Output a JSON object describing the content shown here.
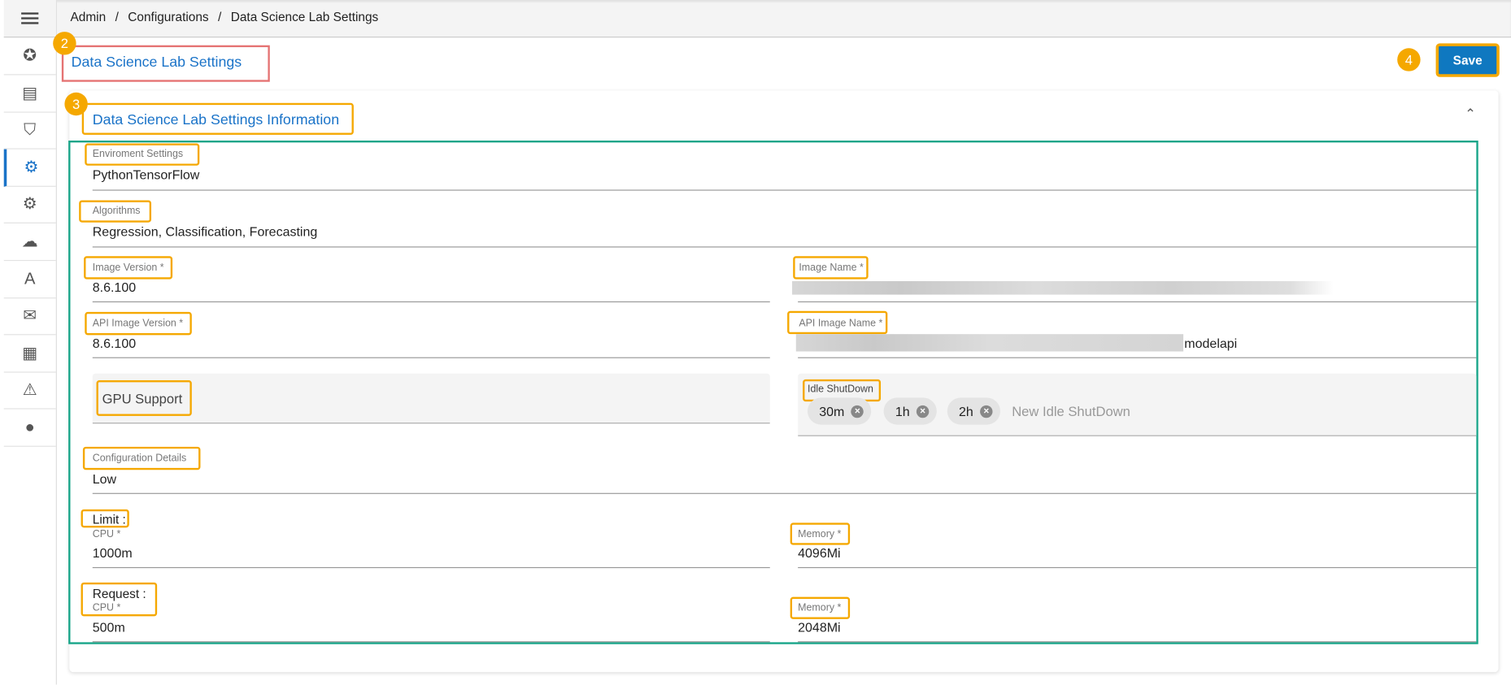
{
  "breadcrumb": [
    "Admin",
    "/",
    "Configurations",
    "/",
    "Data Science Lab Settings"
  ],
  "page_title": "Data Science Lab Settings",
  "save_label": "Save",
  "section_title": "Data Science Lab Settings Information",
  "badges": {
    "title": "2",
    "section": "3",
    "save": "4"
  },
  "sidebar_icons": [
    "menu-icon",
    "admin-badge-icon",
    "billing-icon",
    "security-shield-icon",
    "configurations-gears-icon",
    "document-settings-icon",
    "cloud-network-icon",
    "language-translate-icon",
    "certificate-icon",
    "calendar-search-icon",
    "server-alert-icon",
    "user-clock-icon"
  ],
  "fields": {
    "environment": {
      "label": "Enviroment Settings",
      "value": "PythonTensorFlow"
    },
    "algorithms": {
      "label": "Algorithms",
      "value": "Regression, Classification, Forecasting"
    },
    "image_version": {
      "label": "Image Version *",
      "value": "8.6.100"
    },
    "image_name": {
      "label": "Image Name *"
    },
    "api_image_version": {
      "label": "API Image Version *",
      "value": "8.6.100"
    },
    "api_image_name": {
      "label": "API Image Name *",
      "value_suffix": "modelapi"
    },
    "gpu_support": {
      "label": "GPU Support"
    },
    "idle_shutdown": {
      "label": "Idle ShutDown",
      "chips": [
        "30m",
        "1h",
        "2h"
      ],
      "placeholder": "New Idle ShutDown"
    },
    "configuration_details": {
      "label": "Configuration Details",
      "value": "Low"
    },
    "limit": {
      "heading": "Limit :",
      "cpu_label": "CPU *",
      "cpu": "1000m",
      "memory_label": "Memory *",
      "memory": "4096Mi"
    },
    "request": {
      "heading": "Request :",
      "cpu_label": "CPU *",
      "cpu": "500m",
      "memory_label": "Memory *",
      "memory": "2048Mi"
    }
  },
  "colors": {
    "accent": "#1a73c8",
    "save_bg": "#0f78c0",
    "highlight": "#f5a800",
    "title_box": "#e57373",
    "section_box": "#17a589"
  }
}
